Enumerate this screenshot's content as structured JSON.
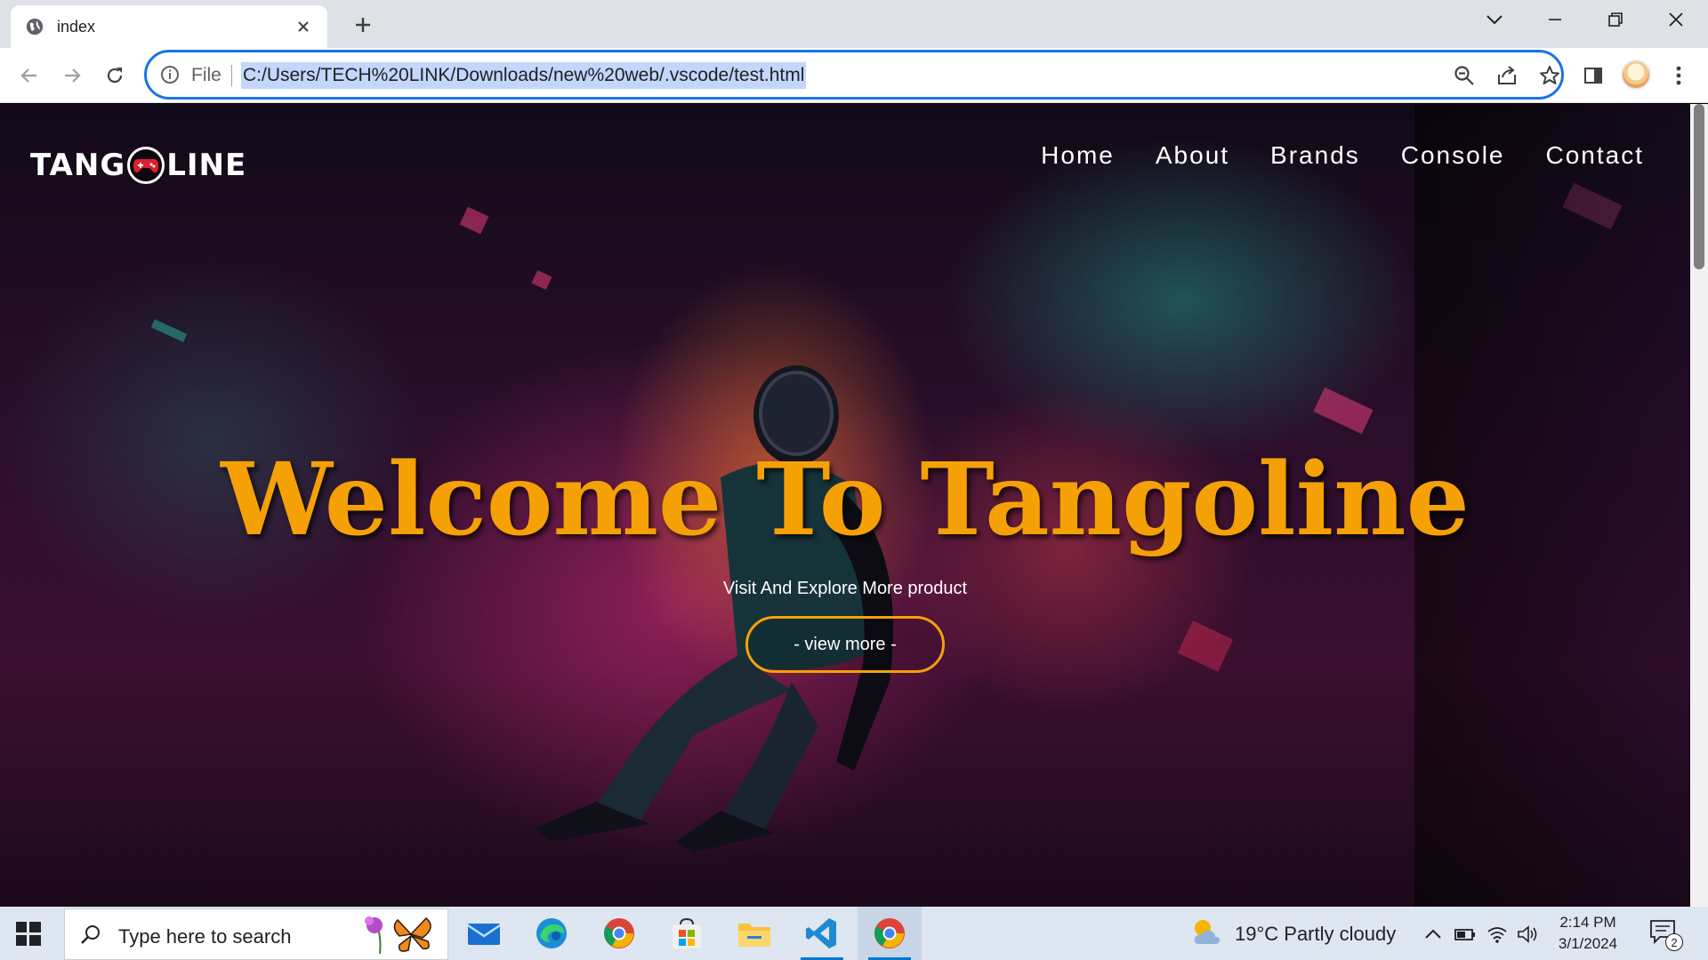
{
  "browser": {
    "tab": {
      "title": "index",
      "icon": "globe-icon"
    },
    "address": {
      "scheme": "File",
      "url": "C:/Users/TECH%20LINK/Downloads/new%20web/.vscode/test.html"
    },
    "accent": "#1a73e8"
  },
  "site": {
    "logo": {
      "left": "TANG",
      "right": "LINE"
    },
    "nav": [
      "Home",
      "About",
      "Brands",
      "Console",
      "Contact"
    ],
    "hero": {
      "title": "Welcome To Tangoline",
      "subtitle": "Visit And Explore More product",
      "button": "- view more -"
    },
    "accent": "#f5a106"
  },
  "taskbar": {
    "search_placeholder": "Type here to search",
    "weather": "19°C  Partly cloudy",
    "time": "2:14 PM",
    "date": "3/1/2024",
    "notifications": "2",
    "apps": [
      "mail-icon",
      "edge-icon",
      "chrome-icon",
      "store-icon",
      "file-explorer-icon",
      "vscode-icon",
      "chrome-icon"
    ]
  }
}
